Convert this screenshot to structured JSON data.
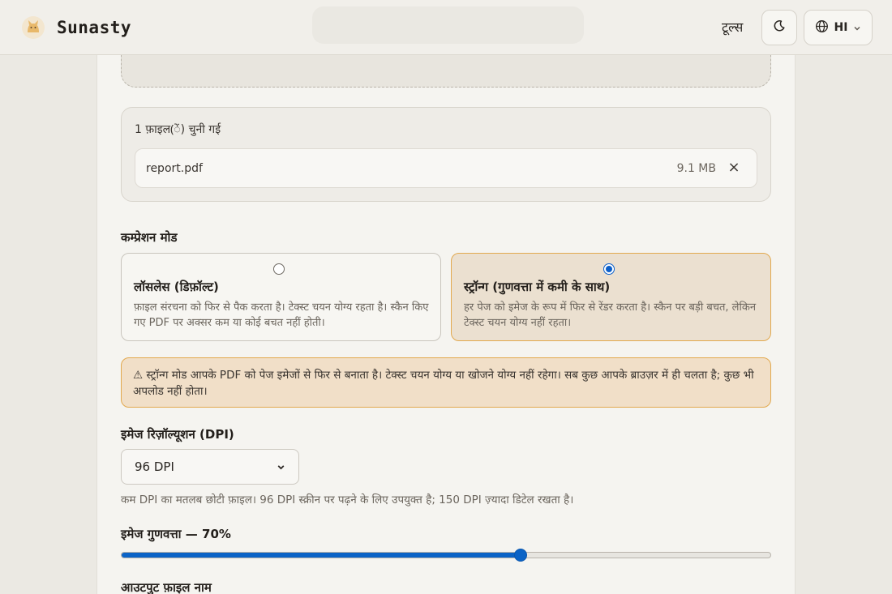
{
  "header": {
    "brand": "Sunasty",
    "tools_label": "टूल्स",
    "language_code": "HI",
    "icons": {
      "logo": "cat-logo-icon",
      "theme": "moon-icon",
      "language": "globe-icon",
      "dropdown": "chevron-down-icon"
    }
  },
  "selected_files": {
    "title": "1 फ़ाइल(ें) चुनी गई",
    "files": [
      {
        "name": "report.pdf",
        "size": "9.1 MB",
        "remove_label": "×"
      }
    ]
  },
  "compression": {
    "label": "कम्प्रेशन मोड",
    "modes": [
      {
        "title": "लॉसलेस (डिफ़ॉल्ट)",
        "description": "फ़ाइल संरचना को फिर से पैक करता है। टेक्स्ट चयन योग्य रहता है। स्कैन किए गए PDF पर अक्सर कम या कोई बचत नहीं होती।",
        "selected": false
      },
      {
        "title": "स्ट्रॉन्ग (गुणवत्ता में कमी के साथ)",
        "description": "हर पेज को इमेज के रूप में फिर से रेंडर करता है। स्कैन पर बड़ी बचत, लेकिन टेक्स्ट चयन योग्य नहीं रहता।",
        "selected": true
      }
    ],
    "warning": "⚠ स्ट्रॉन्ग मोड आपके PDF को पेज इमेजों से फिर से बनाता है। टेक्स्ट चयन योग्य या खोजने योग्य नहीं रहेगा। सब कुछ आपके ब्राउज़र में ही चलता है; कुछ भी अपलोड नहीं होता।"
  },
  "dpi": {
    "label": "इमेज रिज़ॉल्यूशन (DPI)",
    "selected": "96 DPI",
    "hint": "कम DPI का मतलब छोटी फ़ाइल। 96 DPI स्क्रीन पर पढ़ने के लिए उपयुक्त है; 150 DPI ज़्यादा डिटेल रखता है।"
  },
  "quality": {
    "label": "इमेज गुणवत्ता — 70%",
    "value_fraction": 0.615
  },
  "output": {
    "label": "आउटपुट फ़ाइल नाम"
  },
  "colors": {
    "accent": "#0b63c6",
    "warning_border": "#e2a94f",
    "warning_bg": "#f1dfc8"
  }
}
